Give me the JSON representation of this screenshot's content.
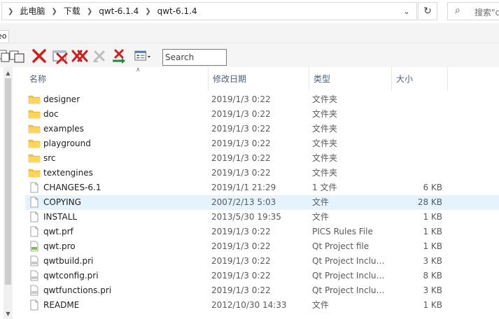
{
  "address": {
    "crumbs": [
      "此电脑",
      "下载",
      "qwt-6.1.4",
      "qwt-6.1.4"
    ],
    "search_placeholder": "搜索\"c"
  },
  "tab": {
    "label": "eo"
  },
  "toolbar": {
    "search_placeholder": "Search"
  },
  "columns": {
    "name": "名称",
    "date": "修改日期",
    "type": "类型",
    "size": "大小"
  },
  "files": [
    {
      "kind": "folder",
      "name": "designer",
      "date": "2019/1/3 0:22",
      "type": "文件夹",
      "size": ""
    },
    {
      "kind": "folder",
      "name": "doc",
      "date": "2019/1/3 0:22",
      "type": "文件夹",
      "size": ""
    },
    {
      "kind": "folder",
      "name": "examples",
      "date": "2019/1/3 0:22",
      "type": "文件夹",
      "size": ""
    },
    {
      "kind": "folder",
      "name": "playground",
      "date": "2019/1/3 0:22",
      "type": "文件夹",
      "size": ""
    },
    {
      "kind": "folder",
      "name": "src",
      "date": "2019/1/3 0:22",
      "type": "文件夹",
      "size": ""
    },
    {
      "kind": "folder",
      "name": "textengines",
      "date": "2019/1/3 0:22",
      "type": "文件夹",
      "size": ""
    },
    {
      "kind": "file",
      "name": "CHANGES-6.1",
      "date": "2019/1/1 21:29",
      "type": "1 文件",
      "size": "6 KB"
    },
    {
      "kind": "file",
      "name": "COPYING",
      "date": "2007/2/13 5:03",
      "type": "文件",
      "size": "28 KB",
      "selected": true
    },
    {
      "kind": "file",
      "name": "INSTALL",
      "date": "2013/5/30 19:35",
      "type": "文件",
      "size": "1 KB"
    },
    {
      "kind": "file",
      "name": "qwt.prf",
      "date": "2019/1/3 0:22",
      "type": "PICS Rules File",
      "size": "1 KB"
    },
    {
      "kind": "pro",
      "name": "qwt.pro",
      "date": "2019/1/3 0:22",
      "type": "Qt Project file",
      "size": "1 KB"
    },
    {
      "kind": "pri",
      "name": "qwtbuild.pri",
      "date": "2019/1/3 0:22",
      "type": "Qt Project Includ...",
      "size": "3 KB"
    },
    {
      "kind": "pri",
      "name": "qwtconfig.pri",
      "date": "2019/1/3 0:22",
      "type": "Qt Project Includ...",
      "size": "8 KB"
    },
    {
      "kind": "pri",
      "name": "qwtfunctions.pri",
      "date": "2019/1/3 0:22",
      "type": "Qt Project Includ...",
      "size": "3 KB"
    },
    {
      "kind": "file",
      "name": "README",
      "date": "2012/10/30 14:33",
      "type": "文件",
      "size": "1 KB"
    }
  ]
}
